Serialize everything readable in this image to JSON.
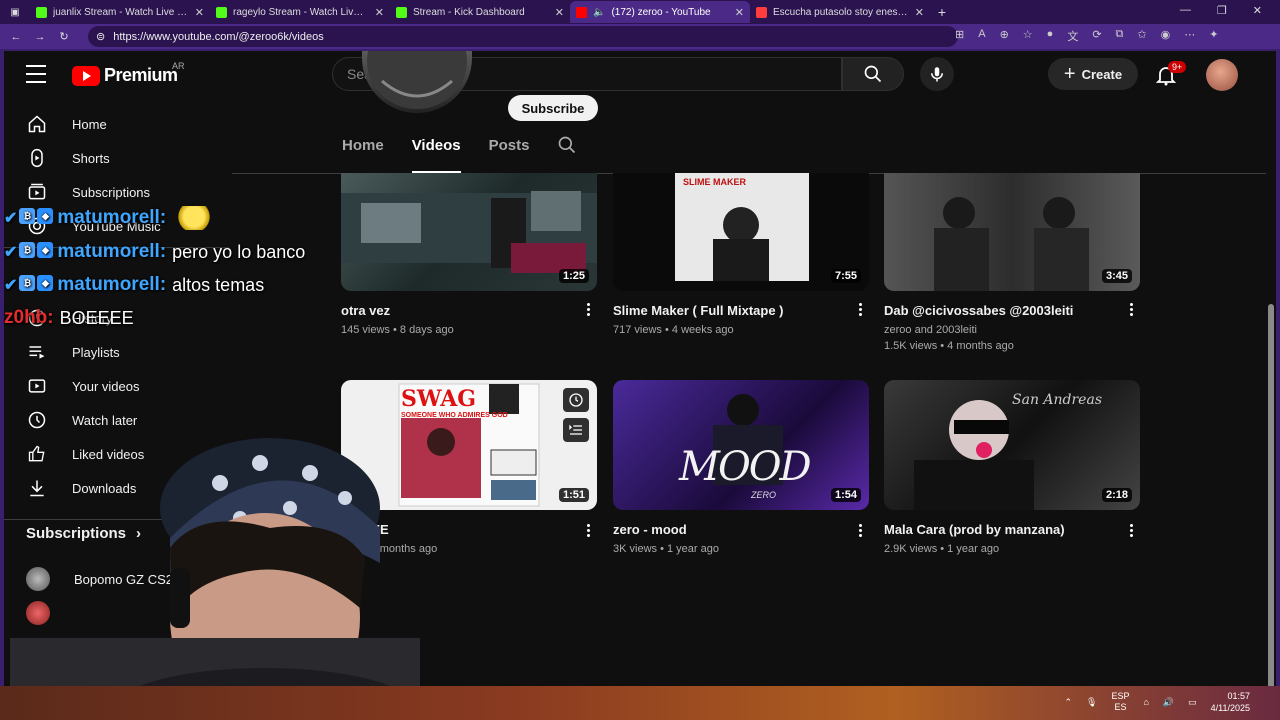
{
  "browser": {
    "tabs": [
      {
        "title": "juanlix Stream - Watch Live on Kick",
        "color": "#53fc18",
        "active": false
      },
      {
        "title": "rageylo Stream - Watch Live on Kick",
        "color": "#53fc18",
        "active": false
      },
      {
        "title": "Stream - Kick Dashboard",
        "color": "#53fc18",
        "active": false
      },
      {
        "title": "(172) zeroo - YouTube",
        "color": "#ff0000",
        "active": true
      },
      {
        "title": "Escucha putasolo stoy enesto de",
        "color": "#ff3d3d",
        "active": false
      }
    ],
    "url": "https://www.youtube.com/@zeroo6k/videos"
  },
  "topbar": {
    "logo": "Premium",
    "country": "AR",
    "search_placeholder": "Search",
    "create_label": "Create",
    "notif_badge": "9+"
  },
  "sidebar": {
    "items": [
      {
        "label": "Home",
        "icon": "home-icon"
      },
      {
        "label": "Shorts",
        "icon": "shorts-icon"
      },
      {
        "label": "Subscriptions",
        "icon": "subscriptions-icon"
      },
      {
        "label": "YouTube Music",
        "icon": "music-icon"
      },
      {
        "label": "History",
        "icon": "history-icon"
      },
      {
        "label": "Playlists",
        "icon": "playlists-icon"
      },
      {
        "label": "Your videos",
        "icon": "your-videos-icon"
      },
      {
        "label": "Watch later",
        "icon": "clock-icon"
      },
      {
        "label": "Liked videos",
        "icon": "thumbs-up-icon"
      },
      {
        "label": "Downloads",
        "icon": "download-icon"
      }
    ],
    "subscriptions_heading": "Subscriptions",
    "subscriptions": [
      {
        "label": "Bopomo GZ CS2"
      },
      {
        "label": ""
      }
    ]
  },
  "channel": {
    "subscribe_label": "Subscribe",
    "tabs": [
      "Home",
      "Videos",
      "Posts"
    ],
    "active_tab": "Videos"
  },
  "videos": [
    {
      "title": "otra vez",
      "views": "145 views",
      "age": "8 days ago",
      "duration": "1:25",
      "extra": ""
    },
    {
      "title": "Slime Maker ( Full Mixtape )",
      "views": "717 views",
      "age": "4 weeks ago",
      "duration": "7:55",
      "extra": ""
    },
    {
      "title": "Dab @cicivossabes @2003leiti",
      "views": "1.5K views",
      "age": "4 months ago",
      "duration": "3:45",
      "extra": "zeroo and 2003leiti"
    },
    {
      "title": "E HAZE",
      "views": "ews",
      "age": "9 months ago",
      "duration": "1:51",
      "extra": ""
    },
    {
      "title": "zero - mood",
      "views": "3K views",
      "age": "1 year ago",
      "duration": "1:54",
      "extra": ""
    },
    {
      "title": "Mala Cara (prod by manzana)",
      "views": "2.9K views",
      "age": "1 year ago",
      "duration": "2:18",
      "extra": ""
    }
  ],
  "thumb_text": {
    "swag": "SWAG",
    "swag_sub": "SOMEONE WHO ADMIRES GOD",
    "mood": "MOOD",
    "mood_sub": "ZERO",
    "slime": "SLIME MAKER"
  },
  "chat": [
    {
      "user": "matumorell:",
      "msg": "",
      "emote": true
    },
    {
      "user": "matumorell:",
      "msg": "pero yo lo banco",
      "emote": false
    },
    {
      "user": "matumorell:",
      "msg": "altos temas",
      "emote": false
    },
    {
      "user": "z0hb:",
      "msg": "BOEEEE",
      "emote": false
    }
  ],
  "taskbar": {
    "lang_top": "ESP",
    "lang_bottom": "ES",
    "time": "01:57",
    "date": "4/11/2025"
  }
}
